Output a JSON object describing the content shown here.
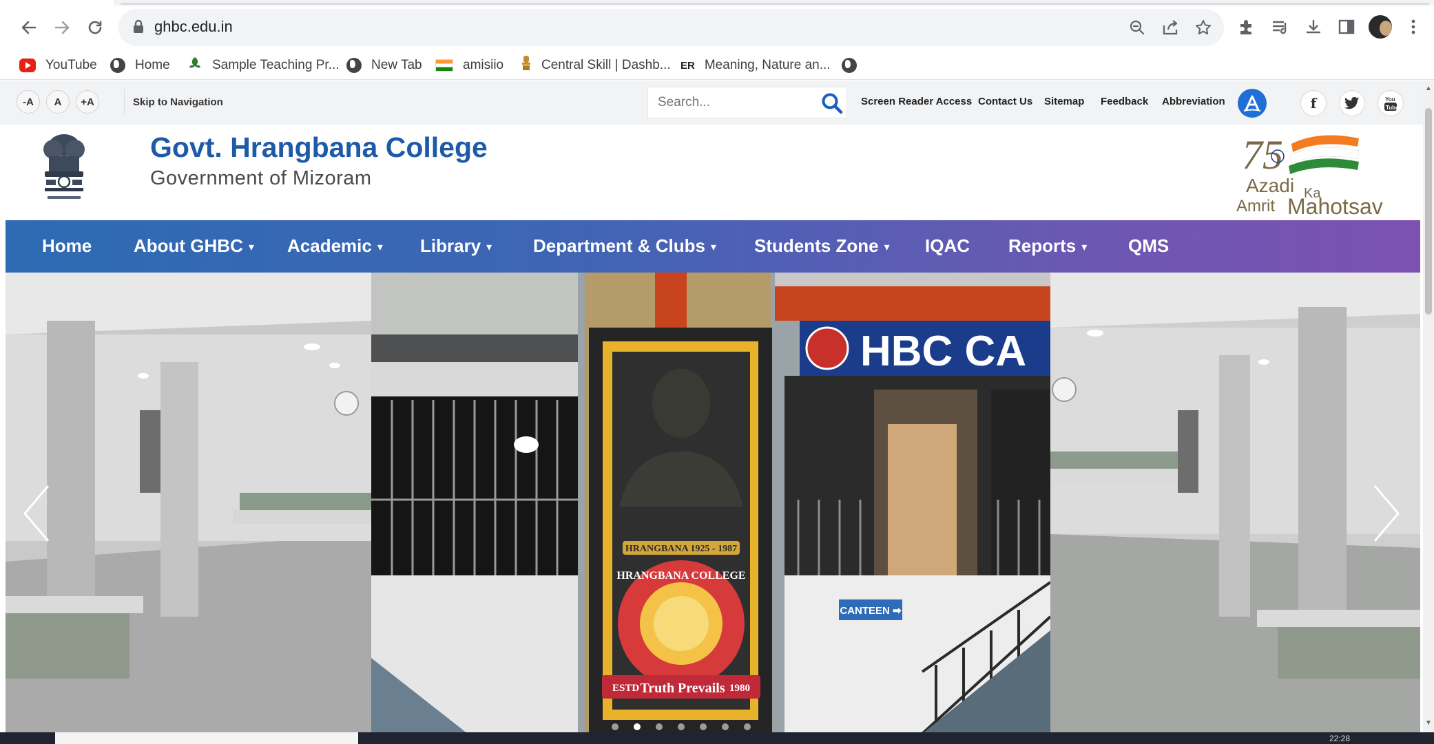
{
  "browser": {
    "url": "ghbc.edu.in",
    "icons": [
      "back-icon",
      "forward-icon",
      "reload-icon",
      "lock-icon",
      "zoom-icon",
      "share-icon",
      "star-icon",
      "extensions-icon",
      "media-icon",
      "download-icon",
      "sidepanel-icon",
      "menu-icon"
    ]
  },
  "bookmarks": [
    {
      "label": "YouTube",
      "icon": "youtube-icon"
    },
    {
      "label": "Home",
      "icon": "globe-icon"
    },
    {
      "label": "Sample Teaching Pr...",
      "icon": "leaf-icon"
    },
    {
      "label": "New Tab",
      "icon": "globe-icon"
    },
    {
      "label": "amisiio",
      "icon": "india-flag-icon"
    },
    {
      "label": "Central Skill | Dashb...",
      "icon": "emblem-icon"
    },
    {
      "label": "Meaning, Nature an...",
      "icon_text": "ER"
    },
    {
      "label": "",
      "icon": "globe-icon"
    }
  ],
  "utility": {
    "font_decrease": "-A",
    "font_normal": "A",
    "font_increase": "+A",
    "skip": "Skip to Navigation",
    "search_placeholder": "Search...",
    "links": [
      "Screen Reader Access",
      "Contact Us",
      "Sitemap",
      "Feedback",
      "Abbreviation"
    ],
    "social": [
      "facebook-icon",
      "twitter-icon",
      "youtube-icon"
    ]
  },
  "header": {
    "title": "Govt. Hrangbana College",
    "subtitle": "Government of Mizoram",
    "logo_text": {
      "line1": "Azadi",
      "ka": "Ka",
      "line2": "Amrit",
      "line3": "Mahotsav",
      "number": "75"
    }
  },
  "nav": [
    {
      "label": "Home",
      "dropdown": false
    },
    {
      "label": "About GHBC",
      "dropdown": true
    },
    {
      "label": "Academic",
      "dropdown": true
    },
    {
      "label": "Library",
      "dropdown": true
    },
    {
      "label": "Department & Clubs",
      "dropdown": true
    },
    {
      "label": "Students Zone",
      "dropdown": true
    },
    {
      "label": "IQAC",
      "dropdown": false
    },
    {
      "label": "Reports",
      "dropdown": true
    },
    {
      "label": "QMS",
      "dropdown": false
    }
  ],
  "hero": {
    "sign_text": "HBC CA",
    "canteen": "CANTEEN ➡",
    "plaque_name": "HRANGBANA 1925 - 1987",
    "seal_top": "HRANGBANA COLLEGE",
    "seal_estd": "ESTD",
    "seal_year": "1980",
    "seal_motto": "Truth Prevails",
    "slide_count": 7,
    "active_slide": 1
  },
  "taskbar": {
    "clock": "22:28"
  },
  "colors": {
    "title_blue": "#1d5aa8",
    "nav_start": "#2d6bb3",
    "nav_end": "#7d51b0",
    "search_icon": "#1a5ec1"
  }
}
